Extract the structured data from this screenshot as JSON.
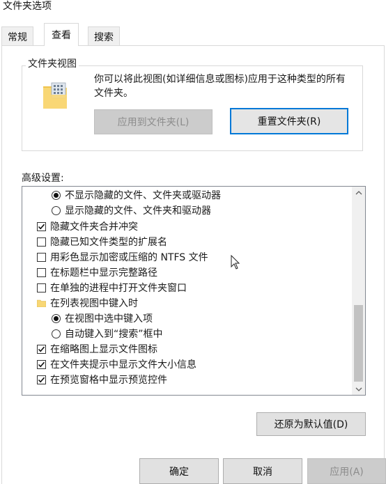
{
  "window": {
    "title": "文件夹选项"
  },
  "tabs": [
    {
      "label": "常规",
      "active": false
    },
    {
      "label": "查看",
      "active": true
    },
    {
      "label": "搜索",
      "active": false
    }
  ],
  "folder_views": {
    "legend": "文件夹视图",
    "description": "你可以将此视图(如详细信息或图标)应用于这种类型的所有文件夹。",
    "apply_button": "应用到文件夹(L)",
    "reset_button": "重置文件夹(R)"
  },
  "advanced": {
    "label": "高级设置:",
    "items": [
      {
        "type": "radio",
        "checked": true,
        "label": "不显示隐藏的文件、文件夹或驱动器"
      },
      {
        "type": "radio",
        "checked": false,
        "label": "显示隐藏的文件、文件夹和驱动器"
      },
      {
        "type": "checkbox",
        "checked": true,
        "label": "隐藏文件夹合并冲突"
      },
      {
        "type": "checkbox",
        "checked": false,
        "label": "隐藏已知文件类型的扩展名"
      },
      {
        "type": "checkbox",
        "checked": false,
        "label": "用彩色显示加密或压缩的 NTFS 文件"
      },
      {
        "type": "checkbox",
        "checked": false,
        "label": "在标题栏中显示完整路径"
      },
      {
        "type": "checkbox",
        "checked": false,
        "label": "在单独的进程中打开文件夹窗口"
      },
      {
        "type": "folder",
        "label": "在列表视图中键入时"
      },
      {
        "type": "radio",
        "checked": true,
        "label": "在视图中选中键入项"
      },
      {
        "type": "radio",
        "checked": false,
        "label": "自动键入到“搜索”框中"
      },
      {
        "type": "checkbox",
        "checked": true,
        "label": "在缩略图上显示文件图标"
      },
      {
        "type": "checkbox",
        "checked": true,
        "label": "在文件夹提示中显示文件大小信息"
      },
      {
        "type": "checkbox",
        "checked": true,
        "label": "在预览窗格中显示预览控件"
      }
    ],
    "restore_button": "还原为默认值(D)"
  },
  "footer": {
    "ok": "确定",
    "cancel": "取消",
    "apply": "应用(A)"
  },
  "colors": {
    "focus_border": "#0078d7",
    "disabled_button": "#cccccc",
    "folder_yellow": "#f8d775"
  },
  "icons": {
    "scroll_up": "chevron-up-icon",
    "scroll_down": "chevron-down-icon",
    "folder": "folder-icon",
    "cursor": "mouse-pointer-icon"
  }
}
